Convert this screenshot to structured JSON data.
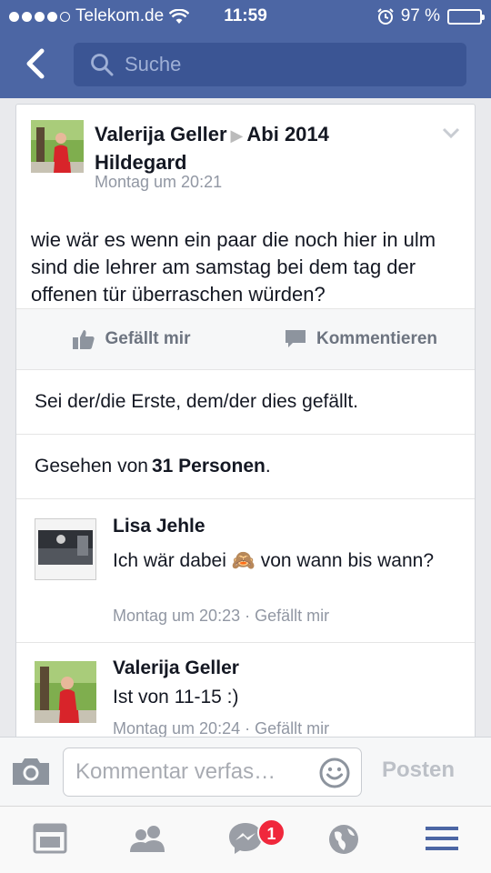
{
  "status_bar": {
    "carrier": "Telekom.de",
    "time": "11:59",
    "battery": "97 %",
    "battery_level": 0.97
  },
  "nav": {
    "search_placeholder": "Suche"
  },
  "post": {
    "author": "Valerija Geller",
    "group": "Abi 2014",
    "author_line2": "Hildegard",
    "time": "Montag um 20:21",
    "text": "wie wär es wenn ein paar die noch hier in ulm sind die lehrer am samstag bei dem tag der offenen tür überraschen würden?",
    "like_label": "Gefällt mir",
    "comment_label": "Kommentieren",
    "likes_text": "Sei der/die Erste, dem/der dies gefällt.",
    "seen_prefix": "Gesehen von",
    "seen_count": "31 Personen",
    "seen_suffix": "."
  },
  "comments": [
    {
      "name": "Lisa Jehle",
      "text": "Ich wär dabei 🙈 von wann bis wann?",
      "time": "Montag um 20:23",
      "like_label": "Gefällt mir"
    },
    {
      "name": "Valerija Geller",
      "text": "Ist von 11-15  :)",
      "time": "Montag um 20:24",
      "like_label": "Gefällt mir"
    }
  ],
  "composer": {
    "placeholder": "Kommentar verfas…",
    "post_label": "Posten"
  },
  "tabbar": {
    "messenger_badge": "1",
    "icons": [
      "news-feed-icon",
      "friends-icon",
      "messenger-icon",
      "globe-icon",
      "menu-icon"
    ]
  },
  "colors": {
    "nav_bg": "#4c66a4",
    "badge": "#f0283c",
    "menu_active": "#4c66a4"
  }
}
